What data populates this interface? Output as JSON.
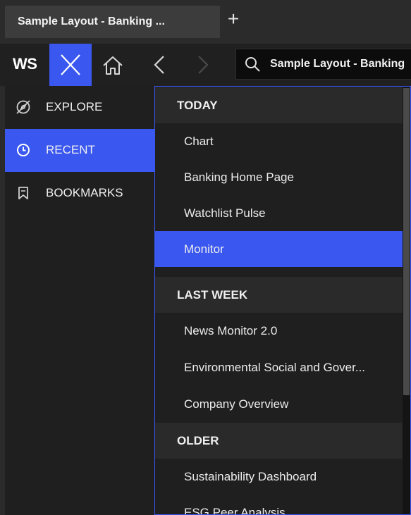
{
  "tab": {
    "title": "Sample Layout - Banking ..."
  },
  "new_tab_symbol": "+",
  "toolbar": {
    "logo": "WS",
    "search_text": "Sample Layout - Banking"
  },
  "colors": {
    "accent": "#3a57f0"
  },
  "sidebar": {
    "items": [
      {
        "label": "EXPLORE",
        "icon": "compass-icon",
        "active": false
      },
      {
        "label": "RECENT",
        "icon": "clock-icon",
        "active": true
      },
      {
        "label": "BOOKMARKS",
        "icon": "bookmark-icon",
        "active": false
      }
    ]
  },
  "recent": {
    "sections": [
      {
        "title": "TODAY",
        "items": [
          "Chart",
          "Banking Home Page",
          "Watchlist Pulse",
          "Monitor"
        ]
      },
      {
        "title": "LAST WEEK",
        "items": [
          "News Monitor 2.0",
          "Environmental Social and Gover...",
          "Company Overview"
        ]
      },
      {
        "title": "OLDER",
        "items": [
          "Sustainability Dashboard",
          "ESG Peer Analysis"
        ]
      }
    ],
    "selected_item": "Monitor"
  }
}
